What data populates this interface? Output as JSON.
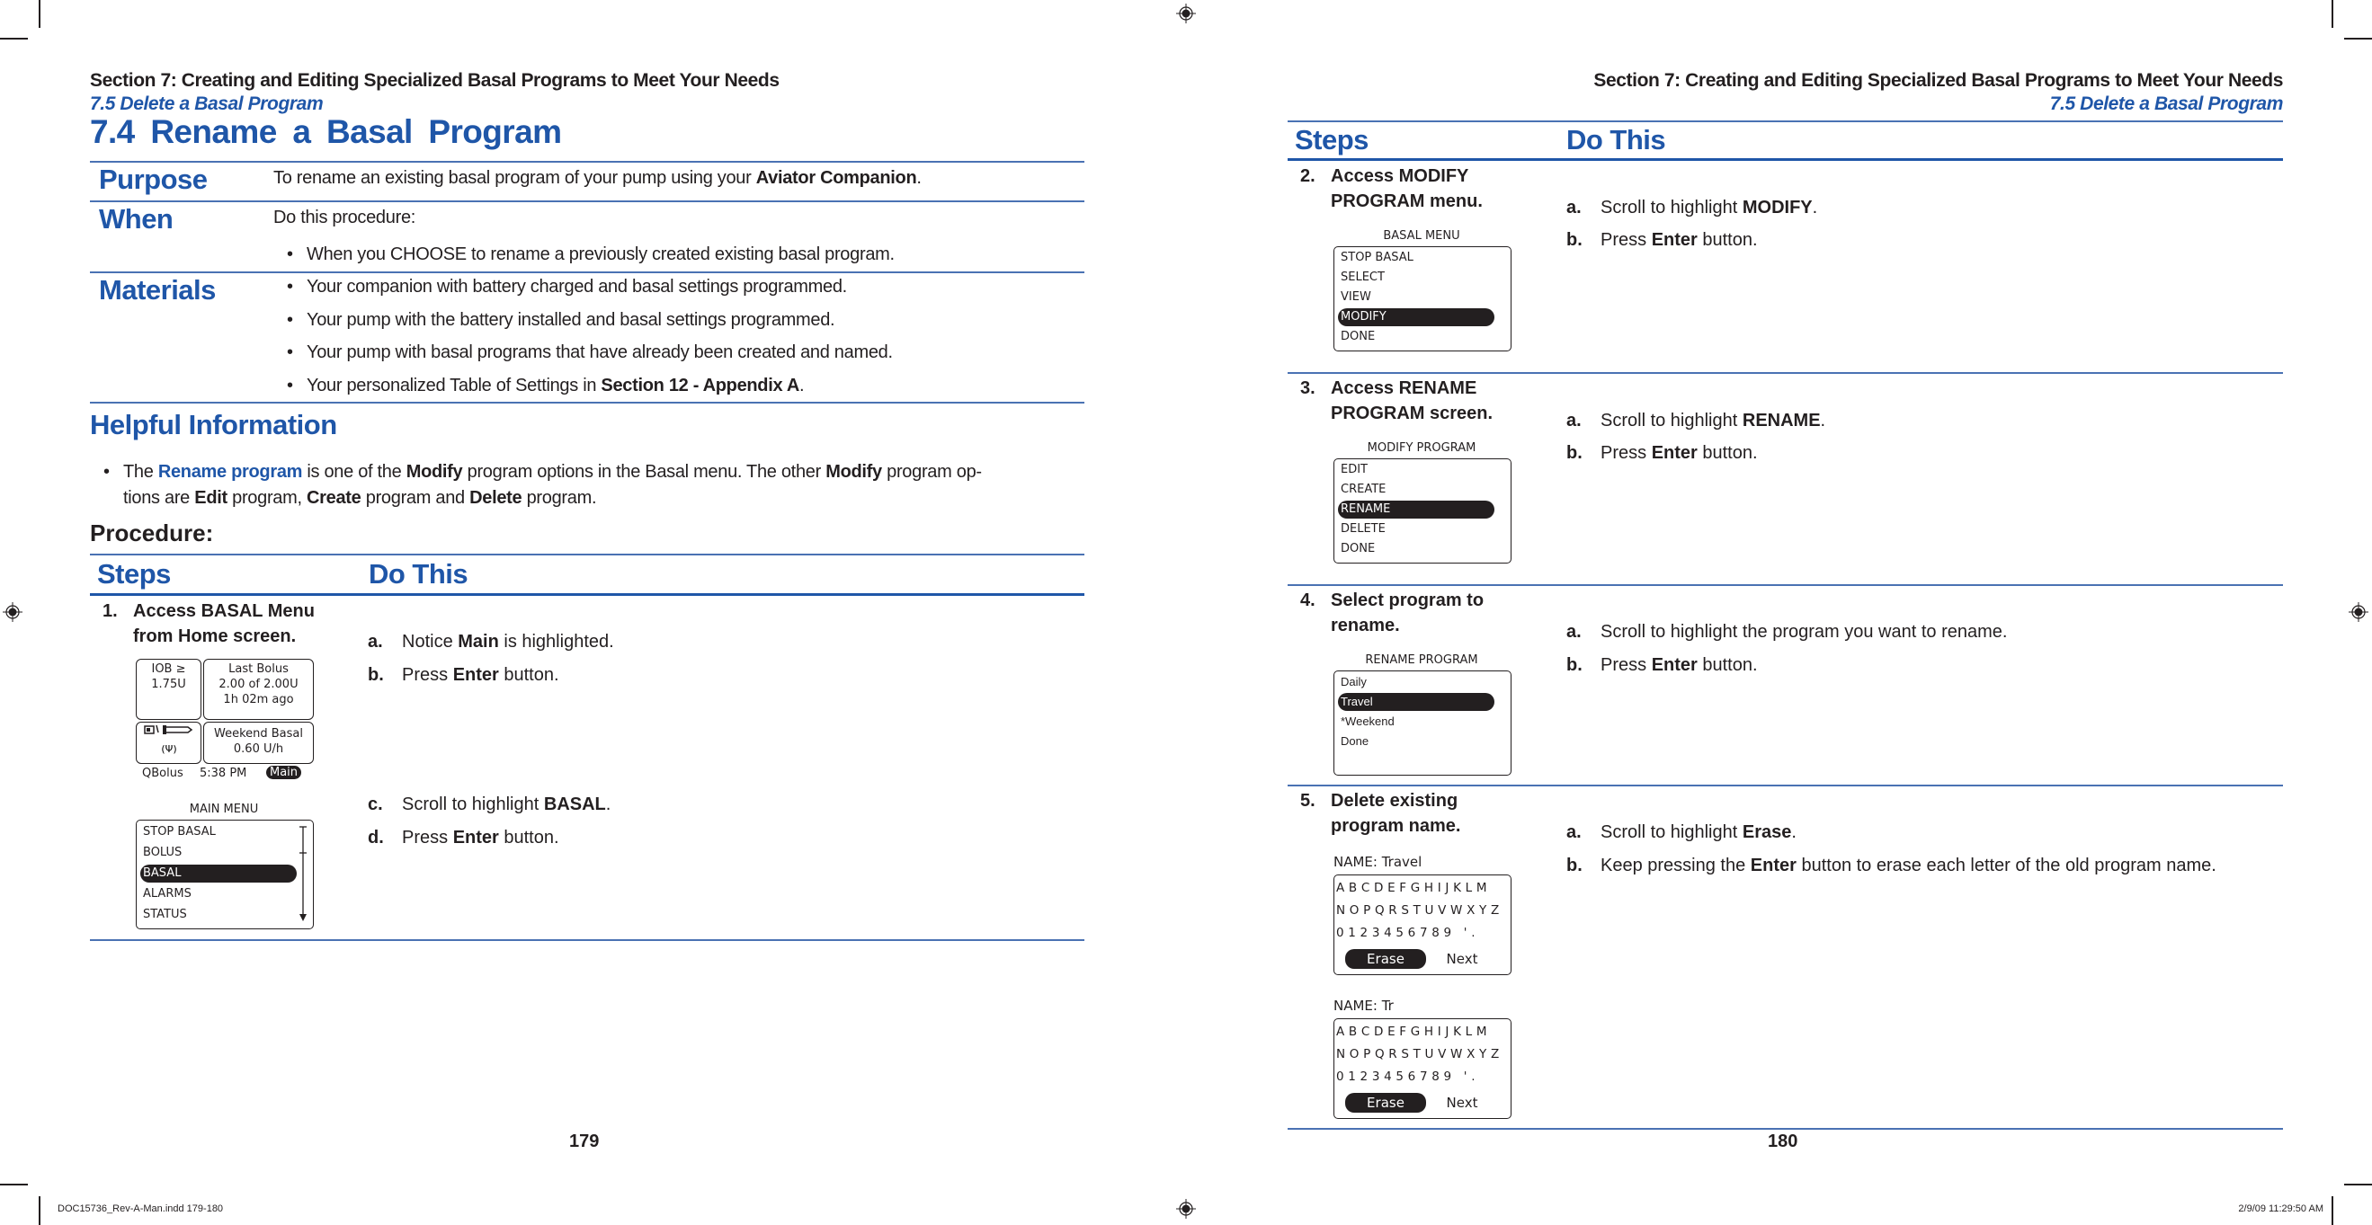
{
  "slug": {
    "file": "DOC15736_Rev-A-Man.indd   179-180",
    "timestamp": "2/9/09   11:29:50 AM"
  },
  "left_page": {
    "running_head": "Section 7: Creating and Editing Specialized Basal Programs to Meet Your Needs",
    "running_sub": "7.5 Delete a Basal Program",
    "title": "7.4  Rename a Basal Program",
    "purpose": {
      "label": "Purpose",
      "text_pre": "To rename an existing basal program of your pump using your ",
      "text_bold": "Aviator Companion",
      "text_post": "."
    },
    "when": {
      "label": "When",
      "intro": "Do this procedure:",
      "bullets": [
        "When you CHOOSE to rename a previously created existing basal program."
      ]
    },
    "materials": {
      "label": "Materials",
      "bullets": [
        "Your companion with battery charged and basal settings programmed.",
        "Your pump with the battery installed and basal settings programmed.",
        "Your pump with basal programs that have already been created and named."
      ],
      "last_pre": "Your personalized Table of Settings in ",
      "last_bold": "Section 12 - Appendix A",
      "last_post": "."
    },
    "helpful": {
      "heading": "Helpful Information",
      "p1": "The ",
      "link": "Rename program",
      "p2": " is one of the ",
      "b1": "Modify",
      "p3": " program options in the Basal menu. The other ",
      "b2": "Modify",
      "p4": " program op-",
      "p5": "tions  are ",
      "b3": "Edit",
      "p6": " program, ",
      "b4": "Create",
      "p7": " program and ",
      "b5": "Delete",
      "p8": " program."
    },
    "procedure_label": "Procedure:",
    "steps_header": "Steps",
    "do_header": "Do This",
    "step1": {
      "num": "1.",
      "title_line1": "Access BASAL Menu",
      "title_line2": "from Home screen.",
      "home_screen": {
        "iob_line1": "IOB ≥",
        "iob_line2": "1.75U",
        "last_bolus_line1": "Last Bolus",
        "last_bolus_line2": "2.00 of 2.00U",
        "last_bolus_line3": "1h 02m ago",
        "status_icons": "battery-signal-icons",
        "basal_line1": "Weekend Basal",
        "basal_line2": "0.60 U/h",
        "qbolus": "QBolus",
        "time": "5:38 PM",
        "main": "Main"
      },
      "main_menu": {
        "title": "MAIN MENU",
        "items": [
          "STOP BASAL",
          "BOLUS",
          "BASAL",
          "ALARMS",
          "STATUS"
        ],
        "selected_index": 2
      },
      "actions": [
        {
          "letter": "a.",
          "pre": "Notice ",
          "bold": "Main",
          "post": " is highlighted."
        },
        {
          "letter": "b.",
          "pre": "Press ",
          "bold": "Enter",
          "post": " button."
        },
        {
          "letter": "c.",
          "pre": "Scroll to highlight ",
          "bold": "BASAL",
          "post": "."
        },
        {
          "letter": "d.",
          "pre": "Press ",
          "bold": "Enter",
          "post": " button."
        }
      ]
    },
    "page_number": "179"
  },
  "right_page": {
    "running_head": "Section 7: Creating and Editing Specialized Basal Programs to Meet Your Needs",
    "running_sub": "7.5 Delete a Basal Program",
    "steps_header": "Steps",
    "do_header": "Do This",
    "steps": [
      {
        "num": "2.",
        "title_line1": "Access MODIFY",
        "title_line2": "PROGRAM menu.",
        "screen_title": "BASAL MENU",
        "items": [
          "STOP BASAL",
          "SELECT",
          "VIEW",
          "MODIFY",
          "DONE"
        ],
        "selected_index": 3,
        "actions": [
          {
            "letter": "a.",
            "pre": "Scroll to highlight ",
            "bold": "MODIFY",
            "post": "."
          },
          {
            "letter": "b.",
            "pre": "Press ",
            "bold": "Enter",
            "post": " button."
          }
        ]
      },
      {
        "num": "3.",
        "title_line1": "Access RENAME",
        "title_line2": "PROGRAM screen.",
        "screen_title": "MODIFY PROGRAM",
        "items": [
          "EDIT",
          "CREATE",
          "RENAME",
          "DELETE",
          "DONE"
        ],
        "selected_index": 2,
        "actions": [
          {
            "letter": "a.",
            "pre": "Scroll to highlight ",
            "bold": "RENAME",
            "post": "."
          },
          {
            "letter": "b.",
            "pre": "Press ",
            "bold": "Enter",
            "post": " button."
          }
        ]
      },
      {
        "num": "4.",
        "title_line1": "Select program to",
        "title_line2": "rename.",
        "screen_title": "RENAME PROGRAM",
        "items": [
          "Daily",
          "Travel",
          "*Weekend",
          "Done"
        ],
        "selected_index": 1,
        "actions": [
          {
            "letter": "a.",
            "pre": "Scroll to highlight the program you want to rename.",
            "bold": "",
            "post": ""
          },
          {
            "letter": "b.",
            "pre": "Press ",
            "bold": "Enter",
            "post": " button."
          }
        ]
      },
      {
        "num": "5.",
        "title_line1": "Delete existing",
        "title_line2": "program name.",
        "name_screens": [
          {
            "name_label": "NAME: Travel"
          },
          {
            "name_label": "NAME: Tr"
          }
        ],
        "keyboard_rows": [
          "ABCDEFGHIJKLM",
          "NOPQRSTUVWXYZ",
          "0123456789 '."
        ],
        "erase": "Erase",
        "next": "Next",
        "actions": [
          {
            "letter": "a.",
            "pre": "Scroll to highlight ",
            "bold": "Erase",
            "post": "."
          },
          {
            "letter": "b.",
            "pre": "Keep pressing the ",
            "bold": "Enter",
            "post": " button to erase each letter of the old program name."
          }
        ]
      }
    ],
    "page_number": "180"
  }
}
